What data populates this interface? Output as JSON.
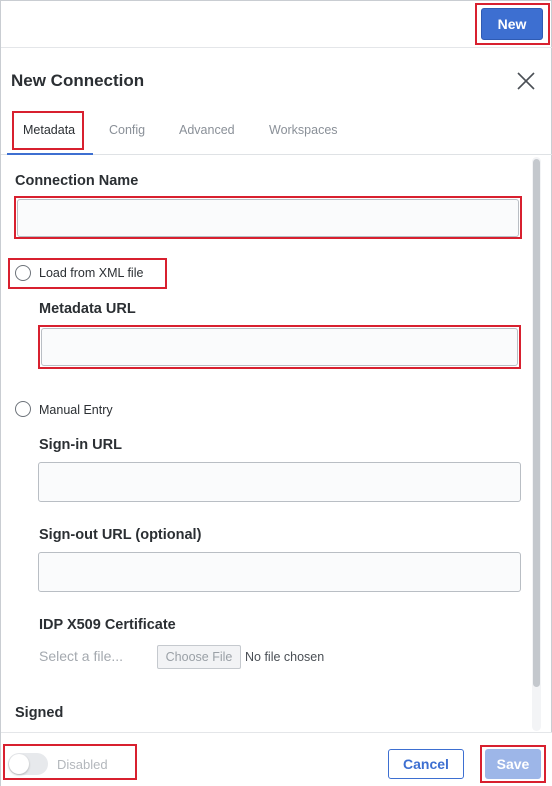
{
  "header": {
    "new_label": "New",
    "title": "New Connection"
  },
  "tabs": [
    {
      "label": "Metadata",
      "active": true
    },
    {
      "label": "Config",
      "active": false
    },
    {
      "label": "Advanced",
      "active": false
    },
    {
      "label": "Workspaces",
      "active": false
    }
  ],
  "form": {
    "connection_name_label": "Connection Name",
    "connection_name_value": "",
    "load_xml_label": "Load from XML file",
    "metadata_url_label": "Metadata URL",
    "metadata_url_value": "",
    "manual_entry_label": "Manual Entry",
    "signin_url_label": "Sign-in URL",
    "signin_url_value": "",
    "signout_url_label": "Sign-out URL (optional)",
    "signout_url_value": "",
    "cert_label": "IDP X509 Certificate",
    "file_placeholder": "Select a file...",
    "choose_file_label": "Choose File",
    "file_status": "No file chosen",
    "signed_label": "Signed"
  },
  "footer": {
    "toggle_label": "Disabled",
    "cancel_label": "Cancel",
    "save_label": "Save"
  },
  "colors": {
    "accent": "#3d6fd1",
    "highlight": "#d8202f"
  }
}
